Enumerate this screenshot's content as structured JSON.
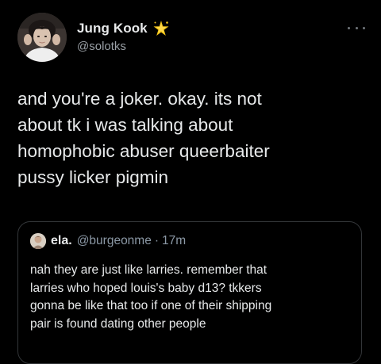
{
  "tweet": {
    "author": {
      "display_name": "Jung Kook",
      "handle": "@solotks",
      "avatar_icon": "avatar-photo",
      "badge_icon": "sparkle-star-emoji"
    },
    "more_icon": "more-horizontal-icon",
    "text_lines": [
      "and you're a joker. okay. its not",
      "about tk i was talking about",
      "homophobic abuser queerbaiter",
      "pussy licker pigmin"
    ]
  },
  "quoted_tweet": {
    "author": {
      "display_name": "ela.",
      "handle": "@burgeonme",
      "avatar_icon": "avatar-photo"
    },
    "separator": "·",
    "time": "17m",
    "text_lines": [
      "nah they are just like larries. remember that",
      "larries who hoped louis's baby d13? tkkers",
      "gonna be like that too if one of their shipping",
      "pair is found dating other people"
    ]
  },
  "colors": {
    "background": "#000000",
    "primary_text": "#e7e9ea",
    "secondary_text": "#8b98a5",
    "border": "#333639",
    "badge": "#f5c518"
  }
}
